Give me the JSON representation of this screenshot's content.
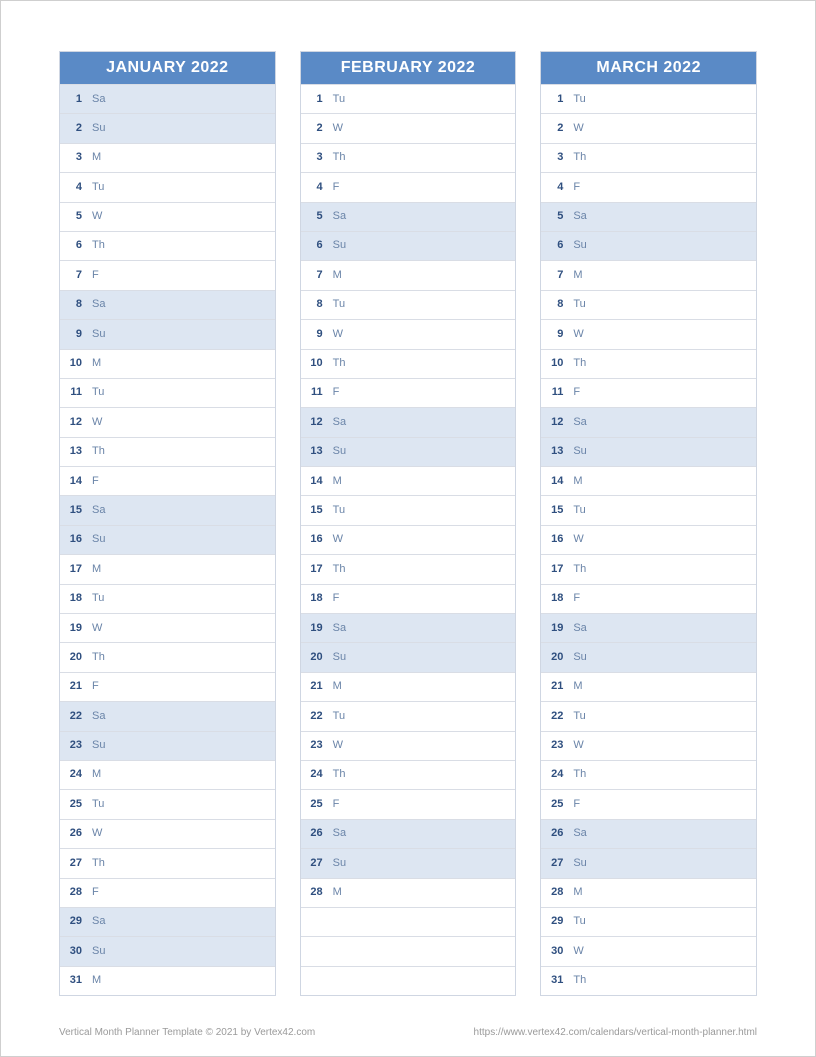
{
  "months": [
    {
      "title": "JANUARY 2022",
      "days": [
        {
          "num": "1",
          "name": "Sa",
          "weekend": true
        },
        {
          "num": "2",
          "name": "Su",
          "weekend": true
        },
        {
          "num": "3",
          "name": "M",
          "weekend": false
        },
        {
          "num": "4",
          "name": "Tu",
          "weekend": false
        },
        {
          "num": "5",
          "name": "W",
          "weekend": false
        },
        {
          "num": "6",
          "name": "Th",
          "weekend": false
        },
        {
          "num": "7",
          "name": "F",
          "weekend": false
        },
        {
          "num": "8",
          "name": "Sa",
          "weekend": true
        },
        {
          "num": "9",
          "name": "Su",
          "weekend": true
        },
        {
          "num": "10",
          "name": "M",
          "weekend": false
        },
        {
          "num": "11",
          "name": "Tu",
          "weekend": false
        },
        {
          "num": "12",
          "name": "W",
          "weekend": false
        },
        {
          "num": "13",
          "name": "Th",
          "weekend": false
        },
        {
          "num": "14",
          "name": "F",
          "weekend": false
        },
        {
          "num": "15",
          "name": "Sa",
          "weekend": true
        },
        {
          "num": "16",
          "name": "Su",
          "weekend": true
        },
        {
          "num": "17",
          "name": "M",
          "weekend": false
        },
        {
          "num": "18",
          "name": "Tu",
          "weekend": false
        },
        {
          "num": "19",
          "name": "W",
          "weekend": false
        },
        {
          "num": "20",
          "name": "Th",
          "weekend": false
        },
        {
          "num": "21",
          "name": "F",
          "weekend": false
        },
        {
          "num": "22",
          "name": "Sa",
          "weekend": true
        },
        {
          "num": "23",
          "name": "Su",
          "weekend": true
        },
        {
          "num": "24",
          "name": "M",
          "weekend": false
        },
        {
          "num": "25",
          "name": "Tu",
          "weekend": false
        },
        {
          "num": "26",
          "name": "W",
          "weekend": false
        },
        {
          "num": "27",
          "name": "Th",
          "weekend": false
        },
        {
          "num": "28",
          "name": "F",
          "weekend": false
        },
        {
          "num": "29",
          "name": "Sa",
          "weekend": true
        },
        {
          "num": "30",
          "name": "Su",
          "weekend": true
        },
        {
          "num": "31",
          "name": "M",
          "weekend": false
        }
      ]
    },
    {
      "title": "FEBRUARY 2022",
      "days": [
        {
          "num": "1",
          "name": "Tu",
          "weekend": false
        },
        {
          "num": "2",
          "name": "W",
          "weekend": false
        },
        {
          "num": "3",
          "name": "Th",
          "weekend": false
        },
        {
          "num": "4",
          "name": "F",
          "weekend": false
        },
        {
          "num": "5",
          "name": "Sa",
          "weekend": true
        },
        {
          "num": "6",
          "name": "Su",
          "weekend": true
        },
        {
          "num": "7",
          "name": "M",
          "weekend": false
        },
        {
          "num": "8",
          "name": "Tu",
          "weekend": false
        },
        {
          "num": "9",
          "name": "W",
          "weekend": false
        },
        {
          "num": "10",
          "name": "Th",
          "weekend": false
        },
        {
          "num": "11",
          "name": "F",
          "weekend": false
        },
        {
          "num": "12",
          "name": "Sa",
          "weekend": true
        },
        {
          "num": "13",
          "name": "Su",
          "weekend": true
        },
        {
          "num": "14",
          "name": "M",
          "weekend": false
        },
        {
          "num": "15",
          "name": "Tu",
          "weekend": false
        },
        {
          "num": "16",
          "name": "W",
          "weekend": false
        },
        {
          "num": "17",
          "name": "Th",
          "weekend": false
        },
        {
          "num": "18",
          "name": "F",
          "weekend": false
        },
        {
          "num": "19",
          "name": "Sa",
          "weekend": true
        },
        {
          "num": "20",
          "name": "Su",
          "weekend": true
        },
        {
          "num": "21",
          "name": "M",
          "weekend": false
        },
        {
          "num": "22",
          "name": "Tu",
          "weekend": false
        },
        {
          "num": "23",
          "name": "W",
          "weekend": false
        },
        {
          "num": "24",
          "name": "Th",
          "weekend": false
        },
        {
          "num": "25",
          "name": "F",
          "weekend": false
        },
        {
          "num": "26",
          "name": "Sa",
          "weekend": true
        },
        {
          "num": "27",
          "name": "Su",
          "weekend": true
        },
        {
          "num": "28",
          "name": "M",
          "weekend": false
        },
        {
          "num": "",
          "name": "",
          "weekend": false,
          "empty": true
        },
        {
          "num": "",
          "name": "",
          "weekend": false,
          "empty": true
        },
        {
          "num": "",
          "name": "",
          "weekend": false,
          "empty": true
        }
      ]
    },
    {
      "title": "MARCH 2022",
      "days": [
        {
          "num": "1",
          "name": "Tu",
          "weekend": false
        },
        {
          "num": "2",
          "name": "W",
          "weekend": false
        },
        {
          "num": "3",
          "name": "Th",
          "weekend": false
        },
        {
          "num": "4",
          "name": "F",
          "weekend": false
        },
        {
          "num": "5",
          "name": "Sa",
          "weekend": true
        },
        {
          "num": "6",
          "name": "Su",
          "weekend": true
        },
        {
          "num": "7",
          "name": "M",
          "weekend": false
        },
        {
          "num": "8",
          "name": "Tu",
          "weekend": false
        },
        {
          "num": "9",
          "name": "W",
          "weekend": false
        },
        {
          "num": "10",
          "name": "Th",
          "weekend": false
        },
        {
          "num": "11",
          "name": "F",
          "weekend": false
        },
        {
          "num": "12",
          "name": "Sa",
          "weekend": true
        },
        {
          "num": "13",
          "name": "Su",
          "weekend": true
        },
        {
          "num": "14",
          "name": "M",
          "weekend": false
        },
        {
          "num": "15",
          "name": "Tu",
          "weekend": false
        },
        {
          "num": "16",
          "name": "W",
          "weekend": false
        },
        {
          "num": "17",
          "name": "Th",
          "weekend": false
        },
        {
          "num": "18",
          "name": "F",
          "weekend": false
        },
        {
          "num": "19",
          "name": "Sa",
          "weekend": true
        },
        {
          "num": "20",
          "name": "Su",
          "weekend": true
        },
        {
          "num": "21",
          "name": "M",
          "weekend": false
        },
        {
          "num": "22",
          "name": "Tu",
          "weekend": false
        },
        {
          "num": "23",
          "name": "W",
          "weekend": false
        },
        {
          "num": "24",
          "name": "Th",
          "weekend": false
        },
        {
          "num": "25",
          "name": "F",
          "weekend": false
        },
        {
          "num": "26",
          "name": "Sa",
          "weekend": true
        },
        {
          "num": "27",
          "name": "Su",
          "weekend": true
        },
        {
          "num": "28",
          "name": "M",
          "weekend": false
        },
        {
          "num": "29",
          "name": "Tu",
          "weekend": false
        },
        {
          "num": "30",
          "name": "W",
          "weekend": false
        },
        {
          "num": "31",
          "name": "Th",
          "weekend": false
        }
      ]
    }
  ],
  "footer": {
    "left": "Vertical Month Planner Template © 2021 by Vertex42.com",
    "right": "https://www.vertex42.com/calendars/vertical-month-planner.html"
  }
}
